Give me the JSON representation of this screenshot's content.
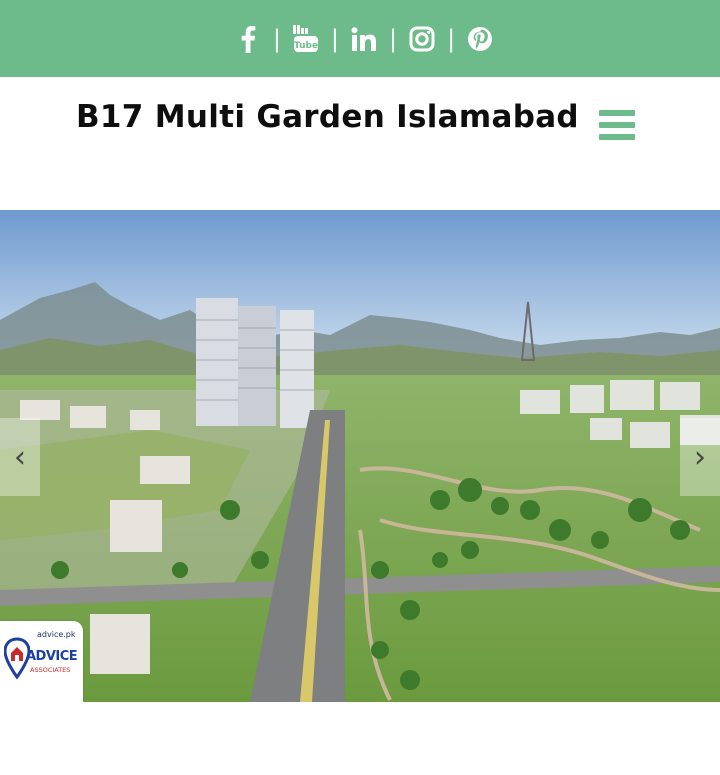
{
  "social": {
    "icons": [
      "facebook-icon",
      "youtube-icon",
      "linkedin-icon",
      "instagram-icon",
      "pinterest-icon"
    ],
    "separator": "|",
    "color": "#ffffff",
    "bar_color": "#6dbb8a"
  },
  "header": {
    "site_title": "B17 Multi Garden Islamabad",
    "menu_icon": "hamburger-icon",
    "accent": "#6dbb8a"
  },
  "hero": {
    "prev_arrow": "‹",
    "next_arrow": "›"
  },
  "watermark": {
    "url": "advice.pk",
    "brand": "ADVICE",
    "subtitle": "ASSOCIATES"
  }
}
